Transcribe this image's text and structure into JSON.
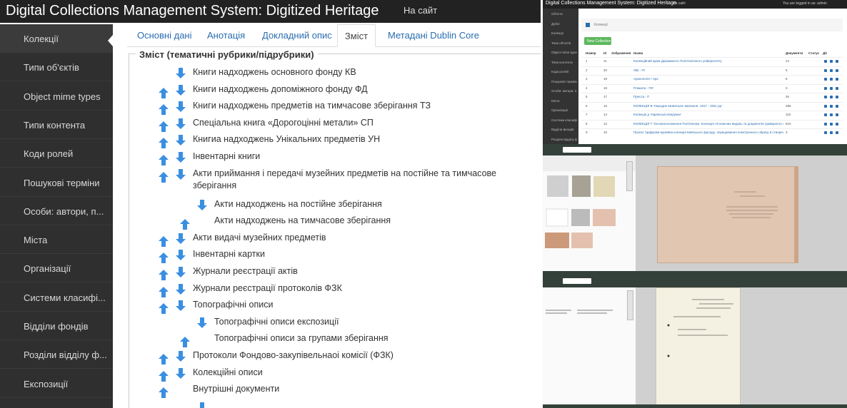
{
  "app": {
    "title": "Digital Collections Management System: Digitized Heritage",
    "site_link": "На сайт"
  },
  "sidebar": {
    "items": [
      {
        "label": "Колекції"
      },
      {
        "label": "Типи об'єктів"
      },
      {
        "label": "Object mime types"
      },
      {
        "label": "Типи контента"
      },
      {
        "label": "Коди ролей"
      },
      {
        "label": "Пошукові терміни"
      },
      {
        "label": "Особи: автори, п..."
      },
      {
        "label": "Міста"
      },
      {
        "label": "Організації"
      },
      {
        "label": "Системи класифі..."
      },
      {
        "label": "Відділи фондів"
      },
      {
        "label": "Розділи відділу ф..."
      },
      {
        "label": "Експозиції"
      }
    ]
  },
  "tabs": [
    {
      "label": "Основні дані"
    },
    {
      "label": "Анотація"
    },
    {
      "label": "Докладний опис"
    },
    {
      "label": "Зміст"
    },
    {
      "label": "Метадані Dublin Core"
    }
  ],
  "toc": {
    "legend": "Зміст (тематичні рубрики/підрубрики)",
    "rows": [
      {
        "label": "Книги надходжень основного фонду КВ",
        "level": 0,
        "up": false,
        "down": true
      },
      {
        "label": "Книги надходжень допоміжного фонду ФД",
        "level": 0,
        "up": true,
        "down": true
      },
      {
        "label": "Книги надходжень предметів на тимчасове зберігання ТЗ",
        "level": 0,
        "up": true,
        "down": true
      },
      {
        "label": "Спеціальна книга «Дорогоцінні метали» СП",
        "level": 0,
        "up": true,
        "down": true
      },
      {
        "label": "Книгиа надходжень Унікальних предметів УН",
        "level": 0,
        "up": true,
        "down": true
      },
      {
        "label": "Інвентарні книги",
        "level": 0,
        "up": true,
        "down": true
      },
      {
        "label": "Акти приймання і передачі музейних предметів на постійне та тимчасове",
        "cont": "зберігання",
        "level": 0,
        "up": true,
        "down": true
      },
      {
        "label": "Акти надходжень на постійне зберігання",
        "level": 1,
        "up": false,
        "down": true
      },
      {
        "label": "Акти надходжень на тимчасове зберігання",
        "level": 1,
        "up": true,
        "down": false
      },
      {
        "label": "Акти видачі музейних предметів",
        "level": 0,
        "up": true,
        "down": true
      },
      {
        "label": "Інвентарні картки",
        "level": 0,
        "up": true,
        "down": true
      },
      {
        "label": "Журнали реєстрації актів",
        "level": 0,
        "up": true,
        "down": true
      },
      {
        "label": "Журнали реєстрації протоколів ФЗК",
        "level": 0,
        "up": true,
        "down": true
      },
      {
        "label": "Топографічні описи",
        "level": 0,
        "up": true,
        "down": true
      },
      {
        "label": "Топографічні описи експозиції",
        "level": 1,
        "up": false,
        "down": true
      },
      {
        "label": "Топографічні описи за групами зберігання",
        "level": 1,
        "up": true,
        "down": false
      },
      {
        "label": "Протоколи Фондово-закупівельнаоі комісії (ФЗК)",
        "level": 0,
        "up": true,
        "down": true
      },
      {
        "label": "Колекційні описи",
        "level": 0,
        "up": true,
        "down": true
      },
      {
        "label": "Внутрішні документи",
        "level": 0,
        "up": true,
        "down": false
      }
    ]
  },
  "colors": {
    "topbar": "#222222",
    "sidebar": "#2f2f2f",
    "tab_link": "#2a6db0",
    "arrow": "#3a8fe0",
    "button_green": "#5cb85c",
    "viewer_bar": "#34413a"
  },
  "icons": {
    "up": "arrow-up-icon",
    "down": "arrow-down-icon"
  },
  "admin_shot": {
    "title": "Digital Collections Management System: Digitized Heritage",
    "site_link": "На сайт",
    "user_text": "You are logged in as: admin",
    "sidebar": [
      "Об'єкти",
      "Дублі",
      "Колекції",
      "Типи об'єктів",
      "Object mime types",
      "Типи контента",
      "Коди ролей",
      "Пошукові терміни",
      "Особи: автори, п...",
      "Міста",
      "Організації",
      "Системи класифі...",
      "Відділи фондів",
      "Розділи відділу ф..."
    ],
    "breadcrumb": "Колекції",
    "new_button": "New Collection",
    "headers": [
      "Номер",
      "Id",
      "Зображення",
      "Назва",
      "Документи",
      "Статус",
      "Дії"
    ],
    "rows": [
      {
        "n": "1",
        "id": "11",
        "title": "Колекційний архів Державного Політехнічного університету",
        "docs": "24"
      },
      {
        "n": "2",
        "id": "20",
        "title": "Ліві - ІП",
        "docs": "5"
      },
      {
        "n": "3",
        "id": "19",
        "title": "Археологія • Арх",
        "docs": "8"
      },
      {
        "n": "4",
        "id": "18",
        "title": "Плакати - ПЛ",
        "docs": "3"
      },
      {
        "n": "5",
        "id": "17",
        "title": "Пресса - П",
        "docs": "26"
      },
      {
        "n": "6",
        "id": "16",
        "title": "КОЛЕКЦІЯ В 'Народне визвольне змагання. 1917 - 1921 рр.'",
        "docs": "386"
      },
      {
        "n": "7",
        "id": "14",
        "title": "Колекція д 'Українські візерунки'",
        "docs": "110"
      },
      {
        "n": "8",
        "id": "12",
        "title": "КОЛЕКЦІЯ Т 'Основоположення Політехніки. Колекція літописних видань та документів гравюрного фонду'",
        "docs": "610"
      },
      {
        "n": "9",
        "id": "10",
        "title": "Проект 'Цифрова музейна колекція Київського фасаду: опрацювання електронного образу в створенню вебчитувача'",
        "docs": "3"
      }
    ]
  }
}
